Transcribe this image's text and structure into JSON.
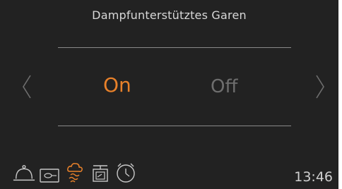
{
  "screen": {
    "title": "Dampfunterstütztes Garen",
    "options": {
      "on": "On",
      "off": "Off"
    },
    "selected": "On",
    "time": "13:46"
  },
  "colors": {
    "background": "#222222",
    "accent": "#e8812a",
    "inactive": "#6e6e6e",
    "text": "#d8d8d8"
  },
  "icons": {
    "prev": "chevron-left-icon",
    "next": "chevron-right-icon",
    "tray": [
      "cloche-icon",
      "meat-probe-icon",
      "steam-assist-icon",
      "scale-icon",
      "timer-icon"
    ]
  }
}
